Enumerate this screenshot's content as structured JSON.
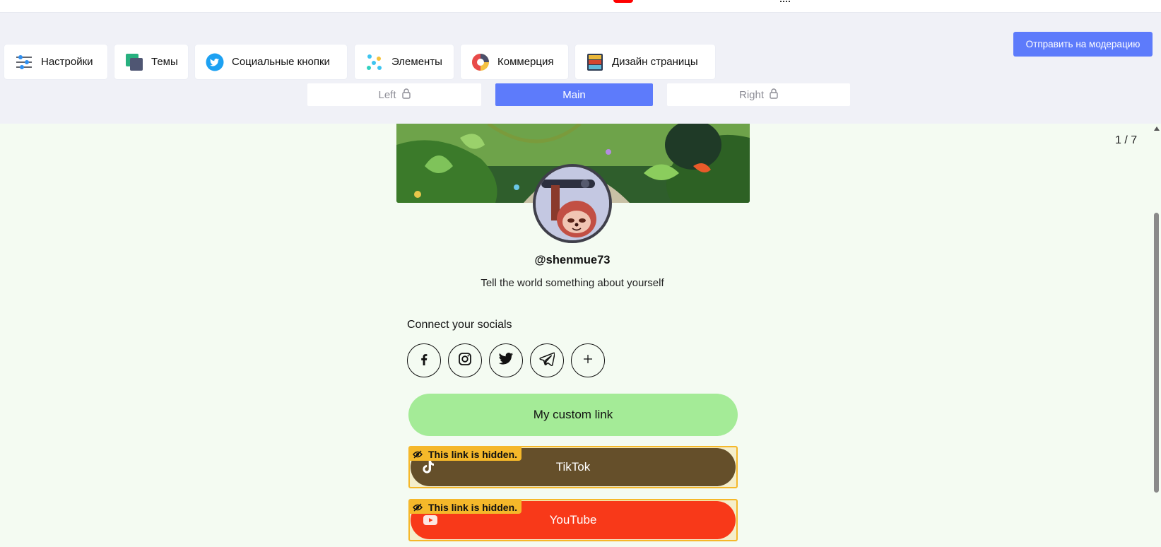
{
  "toolbar": {
    "tabs": [
      {
        "label": "Настройки",
        "icon": "sliders-icon"
      },
      {
        "label": "Темы",
        "icon": "themes-icon"
      },
      {
        "label": "Социальные кнопки",
        "icon": "twitter-icon"
      },
      {
        "label": "Элементы",
        "icon": "elements-icon"
      },
      {
        "label": "Коммерция",
        "icon": "commerce-icon"
      },
      {
        "label": "Дизайн страницы",
        "icon": "page-design-icon"
      }
    ],
    "moderate_label": "Отправить на модерацию",
    "segments": [
      {
        "label": "Left",
        "locked": true,
        "active": false
      },
      {
        "label": "Main",
        "locked": false,
        "active": true
      },
      {
        "label": "Right",
        "locked": true,
        "active": false
      }
    ]
  },
  "profile": {
    "username": "@shenmue73",
    "bio": "Tell the world something about yourself",
    "socials_title": "Connect your socials",
    "socials": [
      "facebook-icon",
      "instagram-icon",
      "twitter-icon",
      "telegram-icon",
      "plus-icon"
    ]
  },
  "links": {
    "custom": "My custom link",
    "hidden_notice": "This link is hidden.",
    "tiktok": "TikTok",
    "youtube": "YouTube"
  },
  "pager": {
    "current": "1 / 7"
  },
  "colors": {
    "accent": "#5d7bfb",
    "page_bg": "#f4fbf2",
    "custom_link": "#a4eb97",
    "tiktok": "#654f2a",
    "youtube": "#f83919",
    "hidden_border": "#f5b82a"
  }
}
